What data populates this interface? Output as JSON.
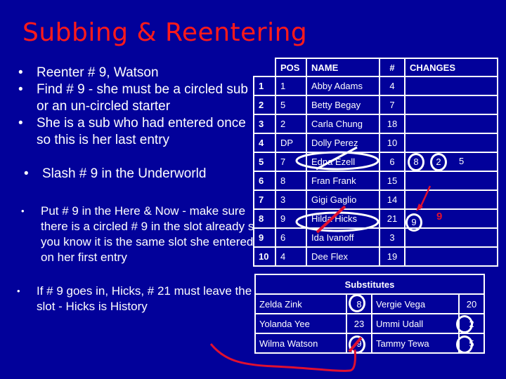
{
  "title": "Subbing & Reentering",
  "bullets_top": [
    "Reenter # 9, Watson",
    "Find # 9 - she must be a circled sub or an un-circled starter",
    "She is a sub who had entered once so this is her last entry"
  ],
  "bullet_slash": "Slash # 9 in the Underworld",
  "bullet_put": "Put # 9 in the Here & Now - make sure there is a circled # 9 in the slot already so you know it is the same slot she entered on her first entry",
  "bullet_hicks": "If # 9 goes in, Hicks, # 21 must leave the slot - Hicks is History",
  "bullet_glyph": "•",
  "lineup": {
    "headers": {
      "pos": "POS",
      "name": "NAME",
      "num": "#",
      "changes": "CHANGES"
    },
    "rows": [
      {
        "slot": "1",
        "pos": "1",
        "name": "Abby Adams",
        "num": "4"
      },
      {
        "slot": "2",
        "pos": "5",
        "name": "Betty Begay",
        "num": "7"
      },
      {
        "slot": "3",
        "pos": "2",
        "name": "Carla Chung",
        "num": "18"
      },
      {
        "slot": "4",
        "pos": "DP",
        "name": "Dolly Perez",
        "num": "10"
      },
      {
        "slot": "5",
        "pos": "7",
        "name": "Edna Ezell",
        "num": "6"
      },
      {
        "slot": "6",
        "pos": "8",
        "name": "Fran Frank",
        "num": "15"
      },
      {
        "slot": "7",
        "pos": "3",
        "name": "Gigi Gaglio",
        "num": "14"
      },
      {
        "slot": "8",
        "pos": "9",
        "name": "Hilda Hicks",
        "num": "21"
      },
      {
        "slot": "9",
        "pos": "6",
        "name": "Ida Ivanoff",
        "num": "3"
      },
      {
        "slot": "10",
        "pos": "4",
        "name": "Dee Flex",
        "num": "19"
      }
    ],
    "changes": {
      "row5": {
        "circled": [
          "8",
          "2"
        ],
        "plain": "5"
      },
      "row8": {
        "circled": [
          "9"
        ],
        "red_note": "9"
      }
    }
  },
  "substitutes": {
    "title": "Substitutes",
    "rows": [
      {
        "name1": "Zelda Zink",
        "num1": "8",
        "name2": "Vergie Vega",
        "num2": "20"
      },
      {
        "name1": "Yolanda Yee",
        "num1": "23",
        "name2": "Ummi Udall",
        "num2": "2"
      },
      {
        "name1": "Wilma Watson",
        "num1": "9",
        "name2": "Tammy Tewa",
        "num2": "5"
      }
    ]
  },
  "colors": {
    "background": "#02019a",
    "title": "#ff1a1a",
    "annotation_red": "#e01030",
    "text": "#ffffff"
  }
}
